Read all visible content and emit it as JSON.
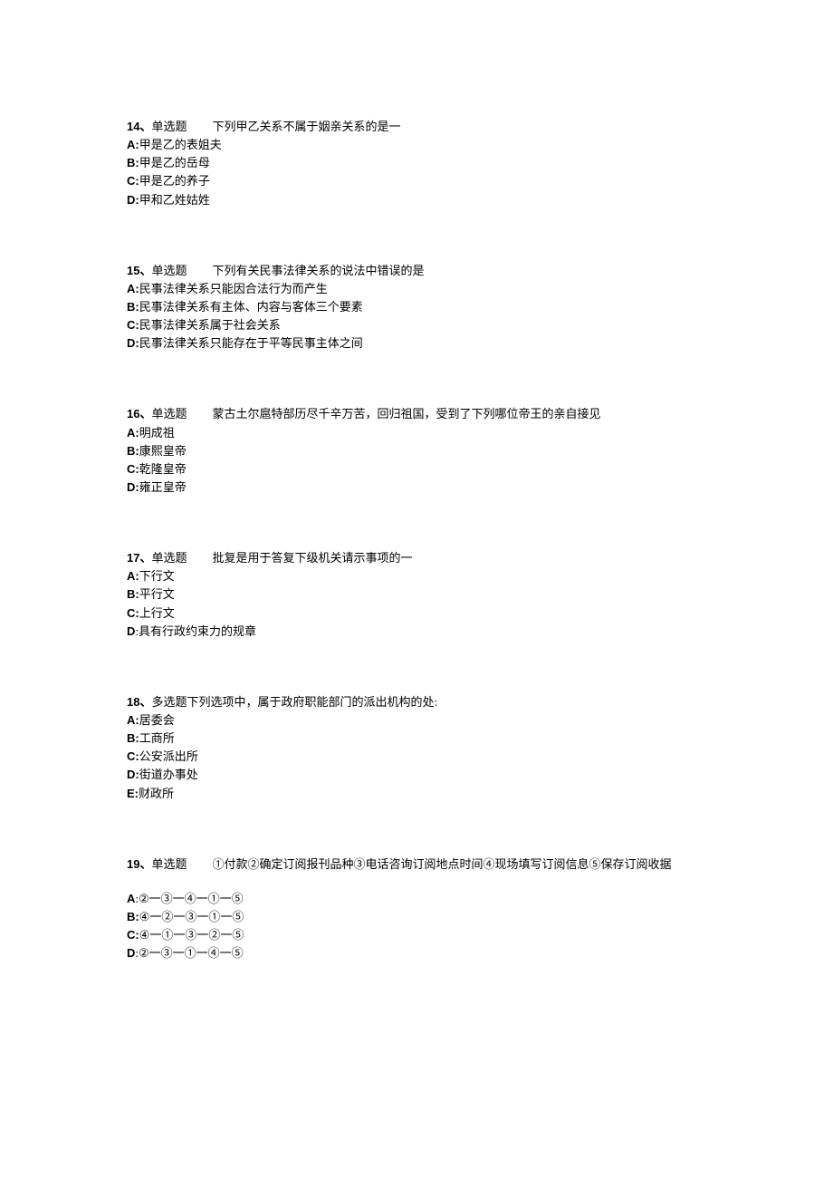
{
  "questions": [
    {
      "num_label": "14、",
      "type": "单选题",
      "stem": "下列甲乙关系不属于姻亲关系的是一",
      "opts": [
        {
          "letter": "A:",
          "text": "甲是乙的表姐夫"
        },
        {
          "letter": "B:",
          "text": "甲是乙的岳母"
        },
        {
          "letter": "C:",
          "text": "甲是乙的养子"
        },
        {
          "letter": "D:",
          "text": "甲和乙姓姑姓"
        }
      ]
    },
    {
      "num_label": "15、",
      "type": "单选题",
      "stem": "下列有关民事法律关系的说法中错误的是",
      "opts": [
        {
          "letter": "A:",
          "text": "民事法律关系只能因合法行为而产生"
        },
        {
          "letter": "B:",
          "text": "民事法律关系有主体、内容与客体三个要素"
        },
        {
          "letter": "C:",
          "text": "民事法律关系属于社会关系"
        },
        {
          "letter": "D:",
          "text": "民事法律关系只能存在于平等民事主体之间"
        }
      ]
    },
    {
      "num_label": "16、",
      "type": "单选题",
      "stem": "蒙古土尔扈特部历尽千辛万苦，回归祖国，受到了下列哪位帝王的亲自接见",
      "opts": [
        {
          "letter": "A:",
          "text": "明成祖"
        },
        {
          "letter": "B:",
          "text": "康熙皇帝"
        },
        {
          "letter": "C:",
          "text": "乾隆皇帝"
        },
        {
          "letter": "D:",
          "text": "雍正皇帝"
        }
      ]
    },
    {
      "num_label": "17、",
      "type": "单选题",
      "stem": "批复是用于答复下级机关请示事项的一",
      "opts": [
        {
          "letter": "A:",
          "text": "下行文"
        },
        {
          "letter": "B:",
          "text": "平行文"
        },
        {
          "letter": "C:",
          "text": "上行文"
        },
        {
          "letter": "D",
          "text": ":具有行政约束力的规章"
        }
      ]
    },
    {
      "num_label": "18、",
      "type": "多选题",
      "stem": "下列选项中，属于政府职能部门的派出机构的处:",
      "opts": [
        {
          "letter": "A:",
          "text": "居委会"
        },
        {
          "letter": "B:",
          "text": "工商所"
        },
        {
          "letter": "C:",
          "text": "公安派出所"
        },
        {
          "letter": "D:",
          "text": "街道办事处"
        },
        {
          "letter": "E:",
          "text": "财政所"
        }
      ]
    },
    {
      "num_label": "19、",
      "type": "单选题",
      "stem": "①付款②确定订阅报刊品种③电话咨询订阅地点时间④现场填写订阅信息⑤保存订阅收据",
      "opts": [
        {
          "letter": "A",
          "text": ":②一③一④一①一⑤"
        },
        {
          "letter": "B:",
          "text": "④一②一③一①一⑤"
        },
        {
          "letter": "C:",
          "text": "④一①一③一②一⑤"
        },
        {
          "letter": "D",
          "text": ":②一③一①一④一⑤"
        }
      ]
    }
  ]
}
